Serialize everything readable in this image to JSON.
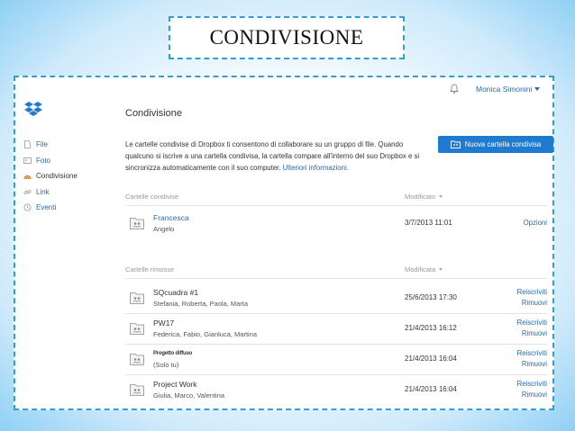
{
  "slide": {
    "title": "CONDIVISIONE"
  },
  "header": {
    "user_name": "Monica Simonini"
  },
  "sidebar": {
    "items": [
      {
        "label": "File",
        "icon": "file-icon"
      },
      {
        "label": "Foto",
        "icon": "photo-icon"
      },
      {
        "label": "Condivisione",
        "icon": "rainbow-share-icon"
      },
      {
        "label": "Link",
        "icon": "link-icon"
      },
      {
        "label": "Eventi",
        "icon": "events-icon"
      }
    ]
  },
  "main": {
    "title": "Condivisione",
    "intro_lines": [
      "Le cartelle condivise di Dropbox ti consentono di collaborare su un gruppo di file. Quando",
      "qualcuno si iscrive a una cartella condivisa, la cartella compare all'interno del suo Dropbox e si",
      "sincronizza automaticamente con il suo computer."
    ],
    "intro_link": "Ulteriori informazioni.",
    "new_folder_button": "Nuova cartella condivisa",
    "shared": {
      "col_name": "Cartelle condivise",
      "col_modified": "Modificato",
      "rows": [
        {
          "name": "Francesca",
          "members": "Angelo",
          "modified": "3/7/2013 11:01",
          "action": "Opzioni"
        }
      ]
    },
    "removed": {
      "col_name": "Cartelle rimosse",
      "col_modified": "Modificata",
      "rows": [
        {
          "name": "SQcuadra #1",
          "members": "Stefania, Roberta, Paola, Marta",
          "modified": "25/6/2013 17:30",
          "action1": "Reiscriviti",
          "action2": "Rimuovi"
        },
        {
          "name": "PW17",
          "members": "Federica, Fabio, Gianluca, Martina",
          "modified": "21/4/2013 16:12",
          "action1": "Reiscriviti",
          "action2": "Rimuovi"
        },
        {
          "name": "Progetto diffuso",
          "members": "(Solo tu)",
          "modified": "21/4/2013 16:04",
          "action1": "Reiscriviti",
          "action2": "Rimuovi"
        },
        {
          "name": "Project Work",
          "members": "Giulia, Marco, Valentina",
          "modified": "21/4/2013 16:04",
          "action1": "Reiscriviti",
          "action2": "Rimuovi"
        }
      ]
    }
  },
  "colors": {
    "accent": "#1f7bd1",
    "link": "#2c6aa8",
    "frame": "#2f9fd8"
  }
}
